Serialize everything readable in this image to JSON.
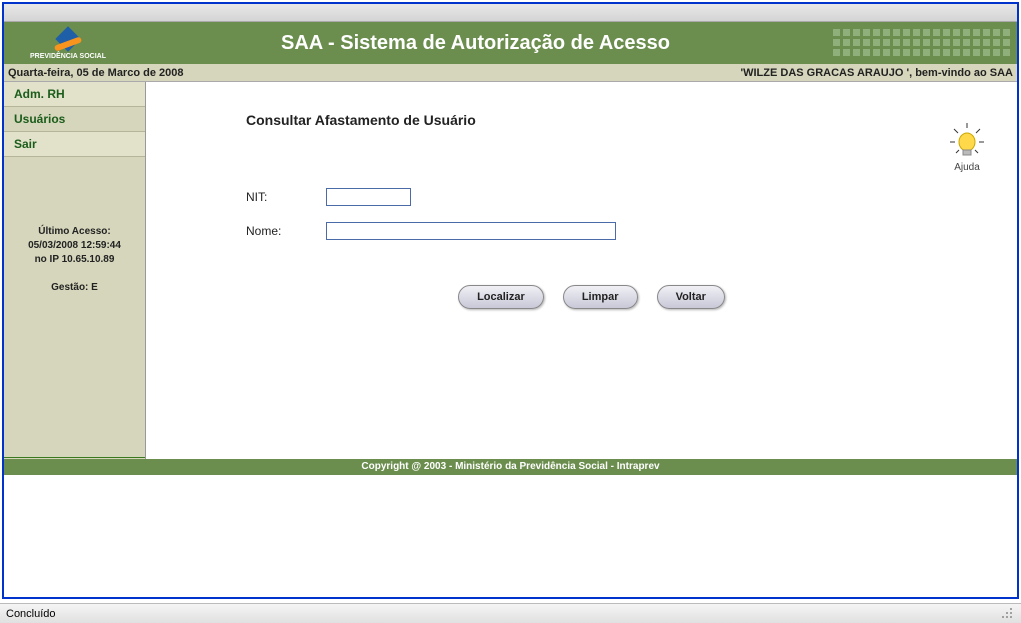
{
  "header": {
    "logo_text": "PREVIDÊNCIA SOCIAL",
    "title": "SAA - Sistema de Autorização de Acesso"
  },
  "infobar": {
    "date": "Quarta-feira, 05 de Marco de 2008",
    "welcome": "'WILZE DAS GRACAS ARAUJO ', bem-vindo ao SAA"
  },
  "sidebar": {
    "items": [
      {
        "label": "Adm. RH"
      },
      {
        "label": "Usuários"
      },
      {
        "label": "Sair"
      }
    ],
    "last_access_label": "Último Acesso:",
    "last_access_value": "05/03/2008 12:59:44",
    "ip_line": "no IP 10.65.10.89",
    "gestao": "Gestão: E"
  },
  "main": {
    "heading": "Consultar Afastamento de Usuário",
    "help_label": "Ajuda",
    "fields": {
      "nit_label": "NIT:",
      "nit_value": "",
      "nome_label": "Nome:",
      "nome_value": ""
    },
    "buttons": {
      "localizar": "Localizar",
      "limpar": "Limpar",
      "voltar": "Voltar"
    }
  },
  "footer": {
    "copyright": "Copyright @ 2003 - Ministério da Previdência Social - Intraprev"
  },
  "statusbar": {
    "text": "Concluído"
  },
  "colors": {
    "header_green": "#6b8e4e",
    "sidebar_bg": "#d6d6bc",
    "link_green": "#1a5c1a"
  }
}
